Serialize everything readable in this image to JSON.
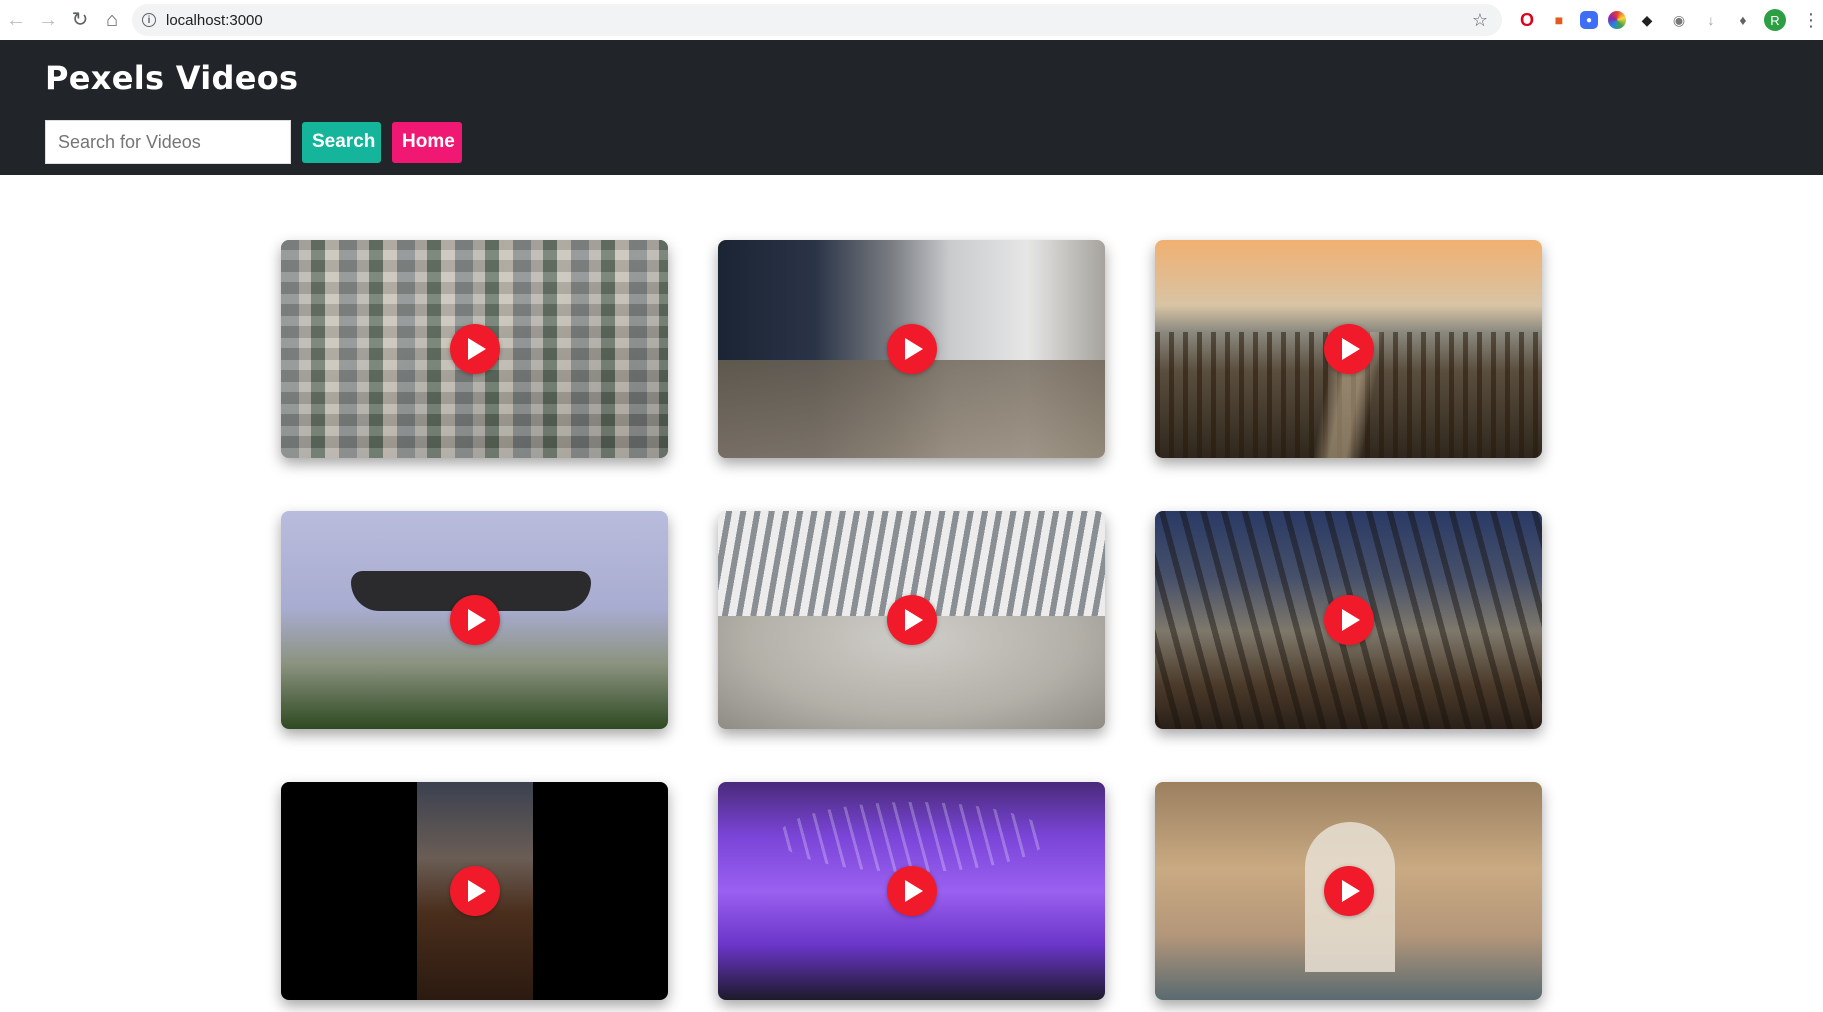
{
  "browser": {
    "url": "localhost:3000",
    "avatar_letter": "R"
  },
  "app": {
    "title": "Pexels Videos",
    "search_placeholder": "Search for Videos",
    "search_value": "",
    "search_button": "Search",
    "home_button": "Home"
  },
  "colors": {
    "header_bg": "#212529",
    "search_button": "#14b59a",
    "home_button": "#f01872",
    "play_button": "#f11a2a"
  },
  "videos": [
    {
      "subject": "aerial city"
    },
    {
      "subject": "workshop worker"
    },
    {
      "subject": "wooden pier at sunset"
    },
    {
      "subject": "drone in flight"
    },
    {
      "subject": "white ribbed hall"
    },
    {
      "subject": "bridge walkway"
    },
    {
      "subject": "hands in coffee beans"
    },
    {
      "subject": "purple sports car"
    },
    {
      "subject": "arched corridor"
    }
  ]
}
